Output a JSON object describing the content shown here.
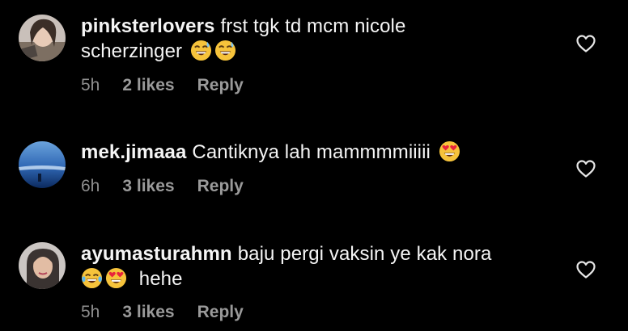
{
  "comments": [
    {
      "username": "pinksterlovers",
      "text_line1": "frst tgk td mcm nicole",
      "text_line2": "scherzinger",
      "emojis": [
        "sweat-smile-emoji",
        "sweat-smile-emoji"
      ],
      "time": "5h",
      "likes": "2 likes",
      "reply_label": "Reply",
      "like_icon": "heart-icon"
    },
    {
      "username": "mek.jimaaa",
      "text_line1": "Cantiknya lah mammmmiiiii",
      "emojis": [
        "heart-eyes-emoji"
      ],
      "time": "6h",
      "likes": "3 likes",
      "reply_label": "Reply",
      "like_icon": "heart-icon"
    },
    {
      "username": "ayumasturahmn",
      "text_line1": "baju pergi vaksin ye kak nora",
      "emojis_line2": [
        "joy-emoji",
        "heart-eyes-emoji"
      ],
      "text_line2": "hehe",
      "time": "5h",
      "likes": "3 likes",
      "reply_label": "Reply",
      "like_icon": "heart-icon"
    }
  ],
  "colors": {
    "background": "#000000",
    "text": "#f5f5f5",
    "meta": "#8e8e8e"
  }
}
